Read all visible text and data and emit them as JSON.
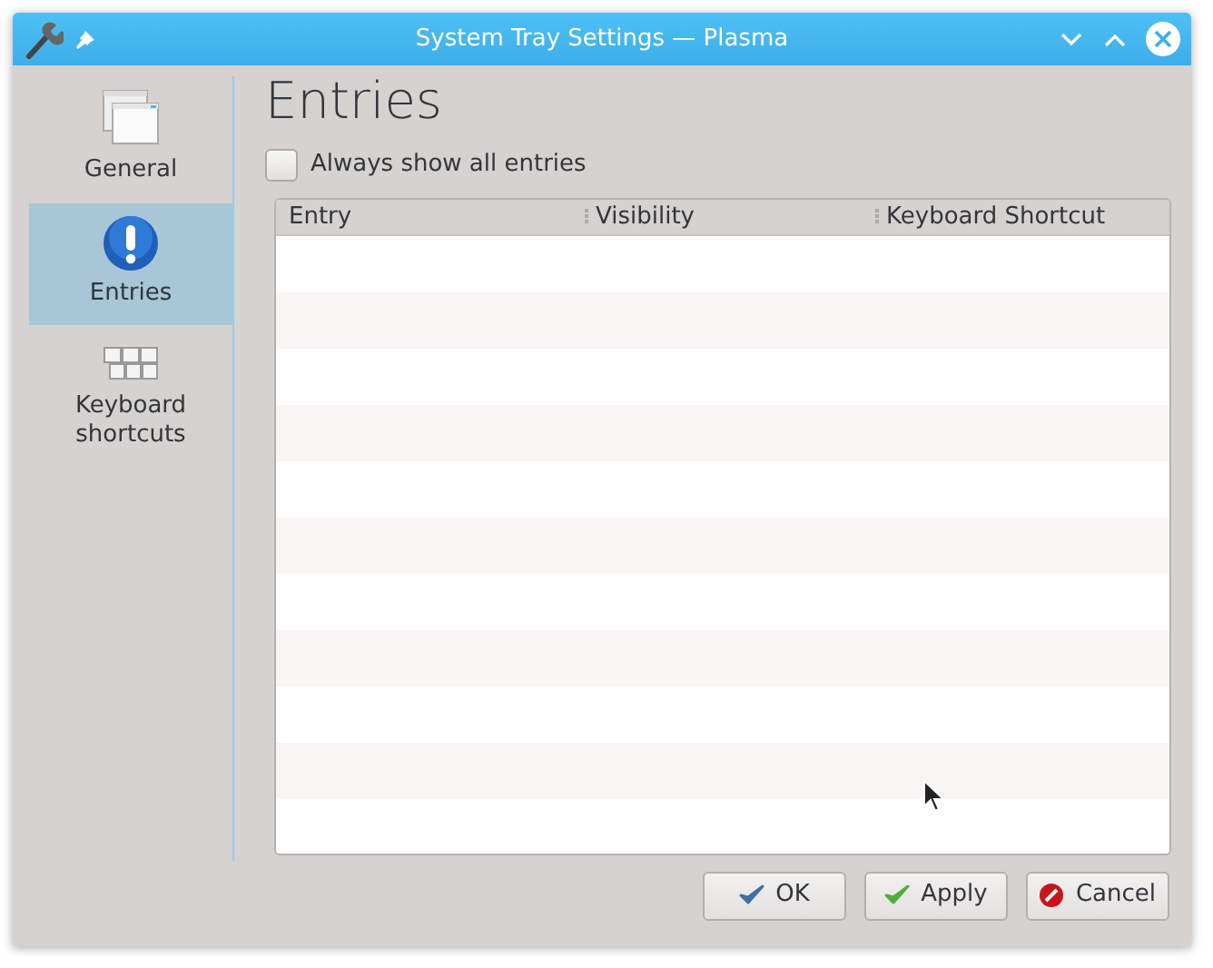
{
  "window": {
    "title": "System Tray Settings — Plasma"
  },
  "sidebar": {
    "items": [
      {
        "label": "General",
        "kind": "window",
        "selected": false
      },
      {
        "label": "Entries",
        "kind": "info",
        "selected": true
      },
      {
        "label": "Keyboard shortcuts",
        "kind": "keyboard",
        "selected": false
      }
    ]
  },
  "page": {
    "heading": "Entries",
    "checkbox": {
      "label": "Always show all entries",
      "checked": false
    },
    "table": {
      "columns": [
        "Entry",
        "Visibility",
        "Keyboard Shortcut"
      ]
    }
  },
  "buttons": [
    {
      "label": "OK",
      "kind": "ok"
    },
    {
      "label": "Apply",
      "kind": "apply"
    },
    {
      "label": "Cancel",
      "kind": "cancel"
    }
  ]
}
